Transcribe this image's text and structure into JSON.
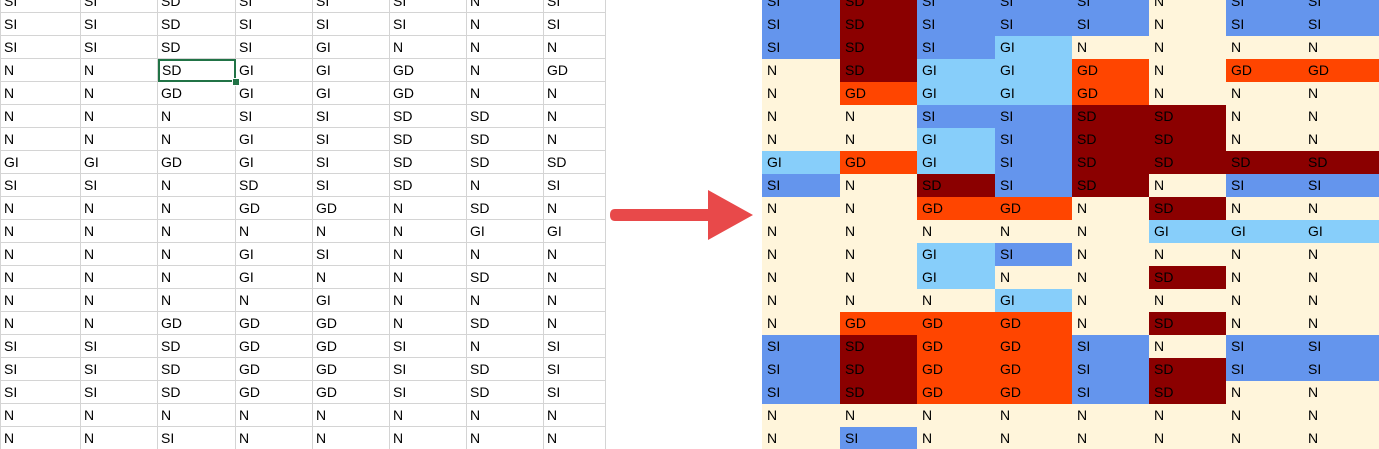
{
  "arrow_color": "#e8494a",
  "category_colors": {
    "N": "#fff5db",
    "SI": "#6495ed",
    "GI": "#87cefa",
    "GD": "#ff4500",
    "SD": "#8b0000"
  },
  "left_grid": {
    "selected_cell": "SD",
    "rows": [
      [
        "SI",
        "SI",
        "SD",
        "SI",
        "SI",
        "SI",
        "N",
        "SI"
      ],
      [
        "SI",
        "SI",
        "SD",
        "SI",
        "SI",
        "SI",
        "N",
        "SI"
      ],
      [
        "SI",
        "SI",
        "SD",
        "SI",
        "GI",
        "N",
        "N",
        "N"
      ],
      [
        "N",
        "N",
        "SD",
        "GI",
        "GI",
        "GD",
        "N",
        "GD"
      ],
      [
        "N",
        "N",
        "GD",
        "GI",
        "GI",
        "GD",
        "N",
        "N"
      ],
      [
        "N",
        "N",
        "N",
        "SI",
        "SI",
        "SD",
        "SD",
        "N"
      ],
      [
        "N",
        "N",
        "N",
        "GI",
        "SI",
        "SD",
        "SD",
        "N"
      ],
      [
        "GI",
        "GI",
        "GD",
        "GI",
        "SI",
        "SD",
        "SD",
        "SD"
      ],
      [
        "SI",
        "SI",
        "N",
        "SD",
        "SI",
        "SD",
        "N",
        "SI"
      ],
      [
        "N",
        "N",
        "N",
        "GD",
        "GD",
        "N",
        "SD",
        "N"
      ],
      [
        "N",
        "N",
        "N",
        "N",
        "N",
        "N",
        "GI",
        "GI"
      ],
      [
        "N",
        "N",
        "N",
        "GI",
        "SI",
        "N",
        "N",
        "N"
      ],
      [
        "N",
        "N",
        "N",
        "GI",
        "N",
        "N",
        "SD",
        "N"
      ],
      [
        "N",
        "N",
        "N",
        "N",
        "GI",
        "N",
        "N",
        "N"
      ],
      [
        "N",
        "N",
        "GD",
        "GD",
        "GD",
        "N",
        "SD",
        "N"
      ],
      [
        "SI",
        "SI",
        "SD",
        "GD",
        "GD",
        "SI",
        "N",
        "SI"
      ],
      [
        "SI",
        "SI",
        "SD",
        "GD",
        "GD",
        "SI",
        "SD",
        "SI"
      ],
      [
        "SI",
        "SI",
        "SD",
        "GD",
        "GD",
        "SI",
        "SD",
        "SI"
      ],
      [
        "N",
        "N",
        "N",
        "N",
        "N",
        "N",
        "N",
        "N"
      ],
      [
        "N",
        "N",
        "SI",
        "N",
        "N",
        "N",
        "N",
        "N"
      ]
    ]
  },
  "right_grid": {
    "rows": [
      [
        "SI",
        "SD",
        "SI",
        "SI",
        "SI",
        "N",
        "SI",
        "SI"
      ],
      [
        "SI",
        "SD",
        "SI",
        "SI",
        "SI",
        "N",
        "SI",
        "SI"
      ],
      [
        "SI",
        "SD",
        "SI",
        "GI",
        "N",
        "N",
        "N",
        "N"
      ],
      [
        "N",
        "SD",
        "GI",
        "GI",
        "GD",
        "N",
        "GD",
        "GD"
      ],
      [
        "N",
        "GD",
        "GI",
        "GI",
        "GD",
        "N",
        "N",
        "N"
      ],
      [
        "N",
        "N",
        "SI",
        "SI",
        "SD",
        "SD",
        "N",
        "N"
      ],
      [
        "N",
        "N",
        "GI",
        "SI",
        "SD",
        "SD",
        "N",
        "N"
      ],
      [
        "GI",
        "GD",
        "GI",
        "SI",
        "SD",
        "SD",
        "SD",
        "SD"
      ],
      [
        "SI",
        "N",
        "SD",
        "SI",
        "SD",
        "N",
        "SI",
        "SI"
      ],
      [
        "N",
        "N",
        "GD",
        "GD",
        "N",
        "SD",
        "N",
        "N"
      ],
      [
        "N",
        "N",
        "N",
        "N",
        "N",
        "GI",
        "GI",
        "GI"
      ],
      [
        "N",
        "N",
        "GI",
        "SI",
        "N",
        "N",
        "N",
        "N"
      ],
      [
        "N",
        "N",
        "GI",
        "N",
        "N",
        "SD",
        "N",
        "N"
      ],
      [
        "N",
        "N",
        "N",
        "GI",
        "N",
        "N",
        "N",
        "N"
      ],
      [
        "N",
        "GD",
        "GD",
        "GD",
        "N",
        "SD",
        "N",
        "N"
      ],
      [
        "SI",
        "SD",
        "GD",
        "GD",
        "SI",
        "N",
        "SI",
        "SI"
      ],
      [
        "SI",
        "SD",
        "GD",
        "GD",
        "SI",
        "SD",
        "SI",
        "SI"
      ],
      [
        "SI",
        "SD",
        "GD",
        "GD",
        "SI",
        "SD",
        "N",
        "N"
      ],
      [
        "N",
        "N",
        "N",
        "N",
        "N",
        "N",
        "N",
        "N"
      ],
      [
        "N",
        "SI",
        "N",
        "N",
        "N",
        "N",
        "N",
        "N"
      ]
    ]
  }
}
